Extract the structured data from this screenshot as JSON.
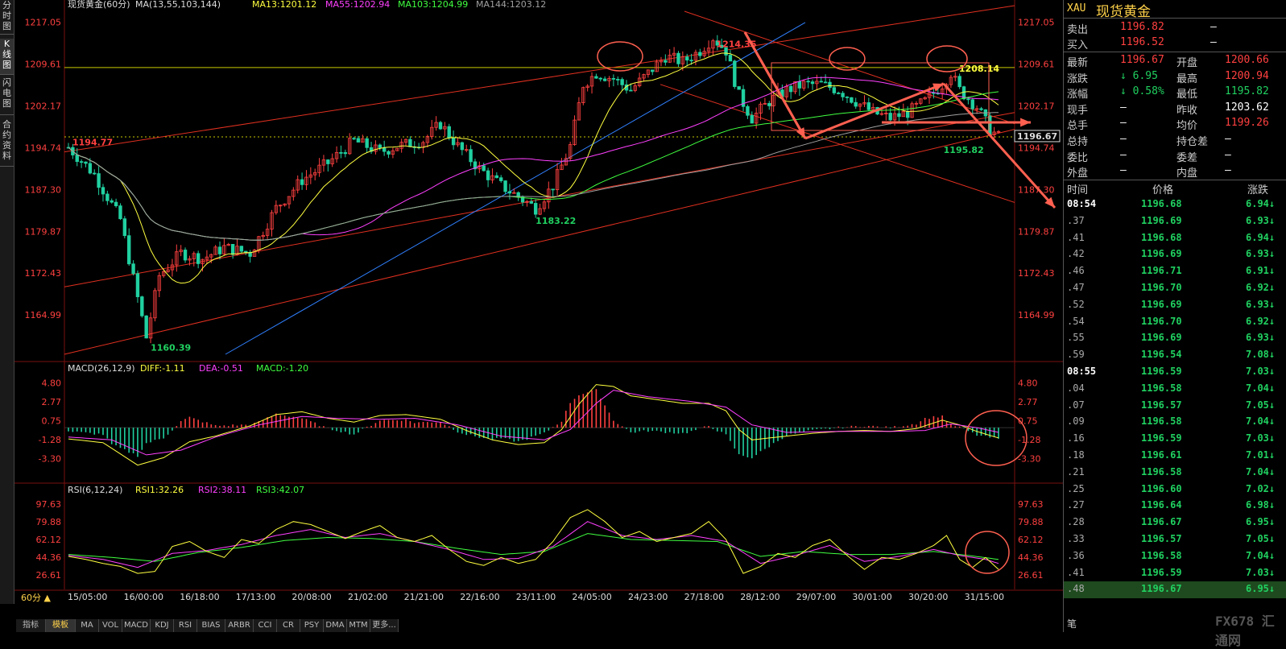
{
  "left_tabs": [
    "分时图",
    "K线图",
    "闪电图",
    "合约资料"
  ],
  "chart_header": {
    "instrument": "现货黄金(60分)",
    "ma_label": "MA(13,55,103,144)",
    "ma13": "MA13:1201.12",
    "ma55": "MA55:1202.94",
    "ma103": "MA103:1204.99",
    "ma144": "MA144:1203.12"
  },
  "macd_header": {
    "name": "MACD(26,12,9)",
    "diff": "DIFF:-1.11",
    "dea": "DEA:-0.51",
    "macd": "MACD:-1.20"
  },
  "rsi_header": {
    "name": "RSI(6,12,24)",
    "rsi1": "RSI1:32.26",
    "rsi2": "RSI2:38.11",
    "rsi3": "RSI3:42.07"
  },
  "colors": {
    "up": "#ff4040",
    "down": "#20d0a0",
    "ma13": "#ffff40",
    "ma55": "#ff40ff",
    "ma103": "#40ff40",
    "ma144": "#a0a0a0",
    "annotation": "#ff6050",
    "blue_line": "#3080ff"
  },
  "chart_data": [
    {
      "type": "candlestick",
      "title": "现货黄金(60分)",
      "y_ticks_left": [
        "1217.05",
        "1209.61",
        "1202.17",
        "1194.74",
        "1187.30",
        "1179.87",
        "1172.43",
        "1164.99"
      ],
      "y_ticks_right": [
        "1217.05",
        "1209.61",
        "1202.17",
        "1194.74",
        "1187.30",
        "1179.87",
        "1172.43",
        "1164.99"
      ],
      "ylim": [
        1158,
        1219
      ],
      "x_labels": [
        "15/05:00",
        "16/00:00",
        "16/18:00",
        "17/13:00",
        "20/08:00",
        "21/02:00",
        "21/21:00",
        "22/16:00",
        "23/11:00",
        "24/05:00",
        "24/23:00",
        "27/18:00",
        "28/12:00",
        "29/07:00",
        "30/01:00",
        "30/20:00",
        "31/15:00"
      ],
      "annotations": {
        "high": "1214.35",
        "low_main": "1160.39",
        "low_mid": "1183.22",
        "start": "1194.77",
        "recent_high": "1208.14",
        "recent_low": "1195.82",
        "last": "1196.67"
      },
      "price_path": [
        [
          0,
          1194.8
        ],
        [
          6,
          1190
        ],
        [
          12,
          1182
        ],
        [
          16,
          1168
        ],
        [
          18,
          1161
        ],
        [
          21,
          1172
        ],
        [
          26,
          1176
        ],
        [
          31,
          1175
        ],
        [
          36,
          1177
        ],
        [
          42,
          1176
        ],
        [
          48,
          1184
        ],
        [
          54,
          1189
        ],
        [
          60,
          1192
        ],
        [
          66,
          1196
        ],
        [
          72,
          1194
        ],
        [
          76,
          1195
        ],
        [
          82,
          1196
        ],
        [
          86,
          1199
        ],
        [
          90,
          1195
        ],
        [
          95,
          1191
        ],
        [
          100,
          1188
        ],
        [
          104,
          1186
        ],
        [
          108,
          1184
        ],
        [
          112,
          1188
        ],
        [
          116,
          1195
        ],
        [
          119,
          1206
        ],
        [
          122,
          1208
        ],
        [
          126,
          1207
        ],
        [
          130,
          1205
        ],
        [
          134,
          1208
        ],
        [
          138,
          1211
        ],
        [
          142,
          1210
        ],
        [
          146,
          1212
        ],
        [
          149,
          1214.3
        ],
        [
          152,
          1212
        ],
        [
          155,
          1204
        ],
        [
          158,
          1200
        ],
        [
          162,
          1203
        ],
        [
          166,
          1205
        ],
        [
          170,
          1206
        ],
        [
          174,
          1206
        ],
        [
          178,
          1205
        ],
        [
          182,
          1203
        ],
        [
          186,
          1201
        ],
        [
          190,
          1200
        ],
        [
          194,
          1201
        ],
        [
          198,
          1203
        ],
        [
          202,
          1206
        ],
        [
          204,
          1208.1
        ],
        [
          206,
          1205
        ],
        [
          210,
          1202
        ],
        [
          213,
          1198
        ],
        [
          215,
          1196.7
        ]
      ]
    },
    {
      "type": "macd",
      "title": "MACD(26,12,9)",
      "y_ticks": [
        "4.80",
        "2.77",
        "0.75",
        "-1.28",
        "-3.30"
      ],
      "ylim": [
        -4.2,
        5.6
      ],
      "diff_path": [
        [
          0,
          -1.2
        ],
        [
          8,
          -1.6
        ],
        [
          16,
          -4.0
        ],
        [
          22,
          -3.2
        ],
        [
          28,
          -1.5
        ],
        [
          34,
          -0.9
        ],
        [
          42,
          0.2
        ],
        [
          48,
          1.4
        ],
        [
          54,
          1.7
        ],
        [
          60,
          1.0
        ],
        [
          66,
          0.6
        ],
        [
          72,
          1.3
        ],
        [
          78,
          1.4
        ],
        [
          86,
          0.9
        ],
        [
          92,
          -0.3
        ],
        [
          98,
          -1.3
        ],
        [
          104,
          -1.8
        ],
        [
          110,
          -1.6
        ],
        [
          114,
          -0.2
        ],
        [
          118,
          2.5
        ],
        [
          122,
          4.6
        ],
        [
          126,
          4.4
        ],
        [
          130,
          3.4
        ],
        [
          136,
          3.0
        ],
        [
          142,
          2.6
        ],
        [
          148,
          2.6
        ],
        [
          152,
          1.8
        ],
        [
          155,
          -0.2
        ],
        [
          158,
          -1.3
        ],
        [
          164,
          -1.0
        ],
        [
          172,
          -0.6
        ],
        [
          178,
          -0.4
        ],
        [
          184,
          -0.3
        ],
        [
          190,
          -0.4
        ],
        [
          196,
          -0.1
        ],
        [
          202,
          0.8
        ],
        [
          206,
          0.3
        ],
        [
          210,
          -0.4
        ],
        [
          215,
          -1.1
        ]
      ],
      "dea_path": [
        [
          0,
          -1.0
        ],
        [
          10,
          -1.3
        ],
        [
          18,
          -2.9
        ],
        [
          26,
          -2.4
        ],
        [
          34,
          -1.0
        ],
        [
          44,
          0.3
        ],
        [
          54,
          1.2
        ],
        [
          62,
          1.0
        ],
        [
          72,
          0.9
        ],
        [
          80,
          1.0
        ],
        [
          90,
          0.3
        ],
        [
          100,
          -0.9
        ],
        [
          110,
          -1.3
        ],
        [
          116,
          -0.2
        ],
        [
          122,
          2.6
        ],
        [
          126,
          4.0
        ],
        [
          134,
          3.3
        ],
        [
          144,
          2.8
        ],
        [
          152,
          2.2
        ],
        [
          158,
          0.3
        ],
        [
          166,
          -0.5
        ],
        [
          178,
          -0.4
        ],
        [
          190,
          -0.4
        ],
        [
          198,
          -0.3
        ],
        [
          204,
          0.4
        ],
        [
          210,
          0.0
        ],
        [
          215,
          -0.5
        ]
      ]
    },
    {
      "type": "rsi",
      "title": "RSI(6,12,24)",
      "y_ticks": [
        "97.63",
        "79.88",
        "62.12",
        "44.36",
        "26.61"
      ],
      "ylim": [
        20,
        104
      ],
      "rsi1_path": [
        [
          0,
          45
        ],
        [
          4,
          42
        ],
        [
          8,
          38
        ],
        [
          12,
          35
        ],
        [
          16,
          28
        ],
        [
          20,
          30
        ],
        [
          24,
          55
        ],
        [
          28,
          60
        ],
        [
          32,
          50
        ],
        [
          36,
          44
        ],
        [
          40,
          62
        ],
        [
          44,
          58
        ],
        [
          48,
          72
        ],
        [
          52,
          80
        ],
        [
          56,
          77
        ],
        [
          60,
          70
        ],
        [
          64,
          63
        ],
        [
          68,
          70
        ],
        [
          72,
          76
        ],
        [
          76,
          64
        ],
        [
          80,
          60
        ],
        [
          84,
          66
        ],
        [
          88,
          52
        ],
        [
          92,
          40
        ],
        [
          96,
          36
        ],
        [
          100,
          44
        ],
        [
          104,
          38
        ],
        [
          108,
          42
        ],
        [
          112,
          60
        ],
        [
          116,
          84
        ],
        [
          120,
          92
        ],
        [
          124,
          80
        ],
        [
          128,
          64
        ],
        [
          132,
          70
        ],
        [
          136,
          60
        ],
        [
          140,
          64
        ],
        [
          144,
          68
        ],
        [
          148,
          80
        ],
        [
          152,
          62
        ],
        [
          156,
          28
        ],
        [
          160,
          35
        ],
        [
          164,
          48
        ],
        [
          168,
          44
        ],
        [
          172,
          56
        ],
        [
          176,
          62
        ],
        [
          180,
          46
        ],
        [
          184,
          32
        ],
        [
          188,
          44
        ],
        [
          192,
          42
        ],
        [
          196,
          48
        ],
        [
          200,
          56
        ],
        [
          203,
          66
        ],
        [
          206,
          42
        ],
        [
          209,
          34
        ],
        [
          212,
          44
        ],
        [
          215,
          32
        ]
      ],
      "rsi2_path": [
        [
          0,
          46
        ],
        [
          8,
          42
        ],
        [
          16,
          34
        ],
        [
          24,
          48
        ],
        [
          32,
          51
        ],
        [
          40,
          57
        ],
        [
          48,
          66
        ],
        [
          56,
          72
        ],
        [
          64,
          64
        ],
        [
          72,
          68
        ],
        [
          80,
          60
        ],
        [
          88,
          52
        ],
        [
          96,
          42
        ],
        [
          104,
          43
        ],
        [
          112,
          55
        ],
        [
          120,
          80
        ],
        [
          128,
          66
        ],
        [
          136,
          62
        ],
        [
          144,
          66
        ],
        [
          152,
          60
        ],
        [
          160,
          38
        ],
        [
          168,
          46
        ],
        [
          176,
          56
        ],
        [
          184,
          40
        ],
        [
          192,
          45
        ],
        [
          200,
          52
        ],
        [
          206,
          46
        ],
        [
          212,
          42
        ],
        [
          215,
          38
        ]
      ],
      "rsi3_path": [
        [
          0,
          47
        ],
        [
          10,
          44
        ],
        [
          20,
          40
        ],
        [
          30,
          49
        ],
        [
          40,
          54
        ],
        [
          50,
          61
        ],
        [
          60,
          64
        ],
        [
          70,
          63
        ],
        [
          80,
          60
        ],
        [
          90,
          53
        ],
        [
          100,
          47
        ],
        [
          110,
          50
        ],
        [
          120,
          68
        ],
        [
          130,
          62
        ],
        [
          140,
          61
        ],
        [
          150,
          60
        ],
        [
          160,
          45
        ],
        [
          170,
          50
        ],
        [
          180,
          47
        ],
        [
          190,
          47
        ],
        [
          200,
          50
        ],
        [
          208,
          46
        ],
        [
          215,
          42
        ]
      ]
    }
  ],
  "bottom_tabs": [
    "指标",
    "模板",
    "MA",
    "VOL",
    "MACD",
    "KDJ",
    "RSI",
    "BIAS",
    "ARBR",
    "CCI",
    "CR",
    "PSY",
    "DMA",
    "MTM",
    "更多..."
  ],
  "period_label": "60分 ▲",
  "right_panel": {
    "code": "XAU",
    "name": "现货黄金",
    "sell_label": "卖出",
    "sell": "1196.82",
    "sell_vol": "—",
    "buy_label": "买入",
    "buy": "1196.52",
    "buy_vol": "—",
    "quotes": [
      {
        "l1": "最新",
        "v1": "1196.67",
        "l2": "开盘",
        "v2": "1200.66"
      },
      {
        "l1": "涨跌",
        "v1": "↓ 6.95",
        "l2": "最高",
        "v2": "1200.94"
      },
      {
        "l1": "涨幅",
        "v1": "↓ 0.58%",
        "l2": "最低",
        "v2": "1195.82"
      },
      {
        "l1": "现手",
        "v1": "—",
        "l2": "昨收",
        "v2": "1203.62"
      },
      {
        "l1": "总手",
        "v1": "—",
        "l2": "均价",
        "v2": "1199.26"
      },
      {
        "l1": "总持",
        "v1": "—",
        "l2": "持仓差",
        "v2": "—"
      },
      {
        "l1": "委比",
        "v1": "—",
        "l2": "委差",
        "v2": "—"
      },
      {
        "l1": "外盘",
        "v1": "—",
        "l2": "内盘",
        "v2": "—"
      }
    ],
    "tick_header": {
      "time": "时间",
      "price": "价格",
      "change": "涨跌"
    },
    "ticks": [
      {
        "t": "08:54",
        "p": "1196.68",
        "c": "6.94"
      },
      {
        "t": ".37",
        "p": "1196.69",
        "c": "6.93"
      },
      {
        "t": ".41",
        "p": "1196.68",
        "c": "6.94"
      },
      {
        "t": ".42",
        "p": "1196.69",
        "c": "6.93"
      },
      {
        "t": ".46",
        "p": "1196.71",
        "c": "6.91"
      },
      {
        "t": ".47",
        "p": "1196.70",
        "c": "6.92"
      },
      {
        "t": ".52",
        "p": "1196.69",
        "c": "6.93"
      },
      {
        "t": ".54",
        "p": "1196.70",
        "c": "6.92"
      },
      {
        "t": ".55",
        "p": "1196.69",
        "c": "6.93"
      },
      {
        "t": ".59",
        "p": "1196.54",
        "c": "7.08"
      },
      {
        "t": "08:55",
        "p": "1196.59",
        "c": "7.03"
      },
      {
        "t": ".04",
        "p": "1196.58",
        "c": "7.04"
      },
      {
        "t": ".07",
        "p": "1196.57",
        "c": "7.05"
      },
      {
        "t": ".09",
        "p": "1196.58",
        "c": "7.04"
      },
      {
        "t": ".16",
        "p": "1196.59",
        "c": "7.03"
      },
      {
        "t": ".18",
        "p": "1196.61",
        "c": "7.01"
      },
      {
        "t": ".21",
        "p": "1196.58",
        "c": "7.04"
      },
      {
        "t": ".25",
        "p": "1196.60",
        "c": "7.02"
      },
      {
        "t": ".27",
        "p": "1196.64",
        "c": "6.98"
      },
      {
        "t": ".28",
        "p": "1196.67",
        "c": "6.95"
      },
      {
        "t": ".33",
        "p": "1196.57",
        "c": "7.05"
      },
      {
        "t": ".36",
        "p": "1196.58",
        "c": "7.04"
      },
      {
        "t": ".41",
        "p": "1196.59",
        "c": "7.03"
      },
      {
        "t": ".48",
        "p": "1196.67",
        "c": "6.95"
      }
    ],
    "footer_tab": "笔"
  },
  "watermark": "FX678 汇通网"
}
